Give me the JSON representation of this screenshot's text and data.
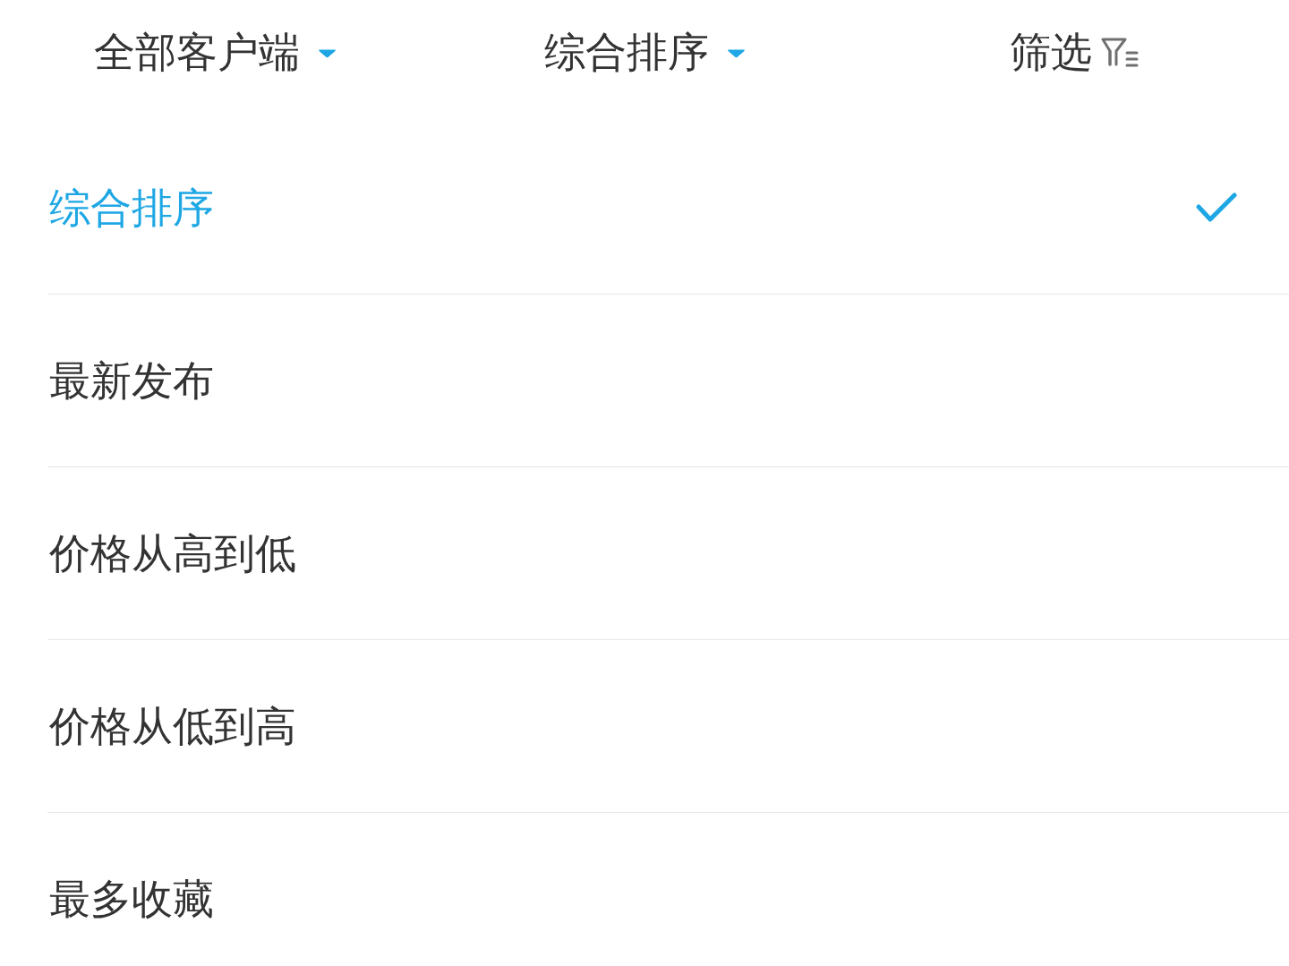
{
  "header_tabs": [
    {
      "label": "全部客户端",
      "kind": "dropdown"
    },
    {
      "label": "综合排序",
      "kind": "dropdown"
    },
    {
      "label": "筛选",
      "kind": "filter"
    }
  ],
  "sort_options": [
    {
      "label": "综合排序",
      "selected": true
    },
    {
      "label": "最新发布",
      "selected": false
    },
    {
      "label": "价格从高到低",
      "selected": false
    },
    {
      "label": "价格从低到高",
      "selected": false
    },
    {
      "label": "最多收藏",
      "selected": false
    }
  ]
}
